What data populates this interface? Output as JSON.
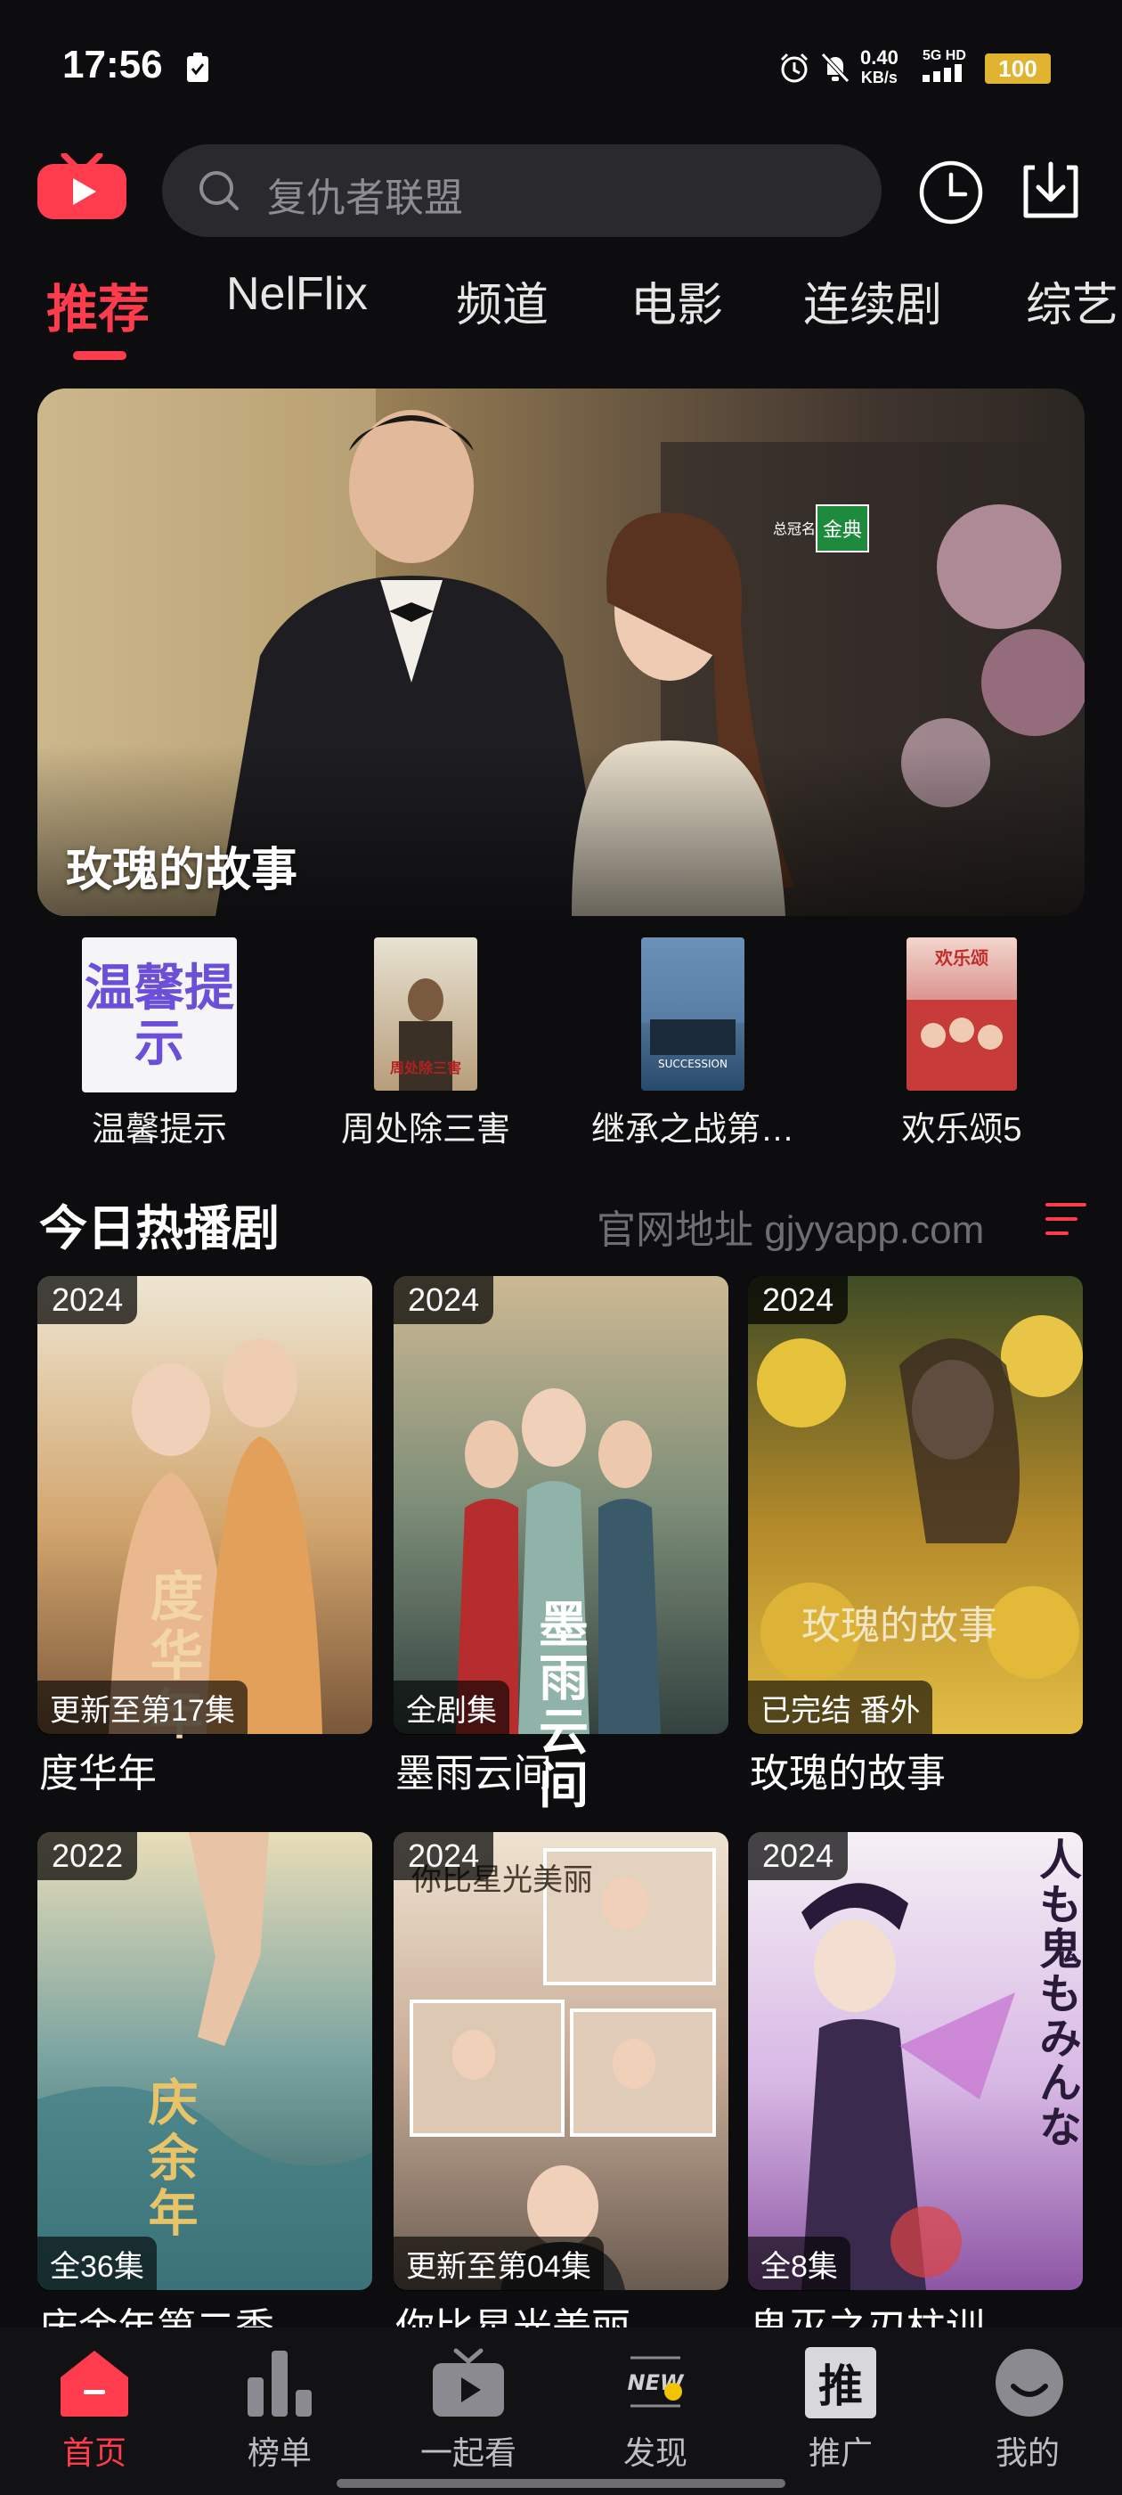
{
  "status_bar": {
    "time": "17:56",
    "network_speed": "0.40",
    "network_unit": "KB/s",
    "signal_text": "5G HD",
    "battery": "100"
  },
  "header": {
    "search_placeholder": "复仇者联盟",
    "icons": [
      "app-logo-icon",
      "search-icon",
      "history-clock-icon",
      "download-icon"
    ]
  },
  "tabs": [
    {
      "label": "推荐",
      "active": true
    },
    {
      "label": "NelFlix"
    },
    {
      "label": "频道"
    },
    {
      "label": "电影"
    },
    {
      "label": "连续剧"
    },
    {
      "label": "综艺"
    }
  ],
  "banner": {
    "title": "玫瑰的故事",
    "badge_pre": "总冠名",
    "badge": "金典"
  },
  "quick_items": [
    {
      "label": "温馨提示",
      "thumb_text": "温馨提示",
      "colors": [
        "#f5f5f8",
        "#6b4fd8"
      ]
    },
    {
      "label": "周处除三害",
      "thumb_text": "周处除三害",
      "colors": [
        "#d9d3c3",
        "#8a6a3c"
      ]
    },
    {
      "label": "继承之战第…",
      "thumb_text": "SUCCESSION",
      "colors": [
        "#2b4f74",
        "#6c8fb1"
      ]
    },
    {
      "label": "欢乐颂5",
      "thumb_text": "欢乐颂",
      "colors": [
        "#c93a3a",
        "#f3d7d0"
      ]
    }
  ],
  "section": {
    "title": "今日热播剧",
    "link": "官网地址 gjyyapp.com"
  },
  "cards": [
    {
      "year": "2024",
      "badge": "更新至第17集",
      "title": "度华年",
      "poster_text": "度华年",
      "colors": [
        "#e9e0cd",
        "#c89a63",
        "#7d5a3c"
      ]
    },
    {
      "year": "2024",
      "badge": "全剧集",
      "title": "墨雨云间",
      "poster_text": "墨雨云间",
      "colors": [
        "#c7b38d",
        "#5e7e74",
        "#2c3d3c"
      ]
    },
    {
      "year": "2024",
      "badge": "已完结 番外",
      "title": "玫瑰的故事",
      "poster_text": "玫瑰的故事",
      "colors": [
        "#3e4a24",
        "#c99a2e",
        "#e4c247"
      ]
    },
    {
      "year": "2022",
      "badge": "全36集",
      "title": "庆余年第二季",
      "poster_text": "庆余年",
      "colors": [
        "#e6d7b1",
        "#5b8a92",
        "#2f5b5e"
      ]
    },
    {
      "year": "2024",
      "badge": "更新至第04集",
      "title": "你比星光美丽",
      "poster_text": "你比星光美丽",
      "colors": [
        "#e7d9c7",
        "#b79b86",
        "#3a3a3a"
      ]
    },
    {
      "year": "2024",
      "badge": "全8集",
      "title": "鬼灭之刃柱训…",
      "poster_text": "人も鬼もみんな",
      "colors": [
        "#f3eef5",
        "#b88ad0",
        "#7a3b8f"
      ]
    }
  ],
  "bottom_nav": [
    {
      "label": "首页",
      "icon": "home-icon",
      "active": true
    },
    {
      "label": "榜单",
      "icon": "chart-icon"
    },
    {
      "label": "一起看",
      "icon": "tv-play-icon"
    },
    {
      "label": "发现",
      "icon": "discover-new-icon",
      "icon_text": "NEW"
    },
    {
      "label": "推广",
      "icon": "promote-icon",
      "icon_text": "推"
    },
    {
      "label": "我的",
      "icon": "profile-icon"
    }
  ],
  "theme": {
    "accent": "#ff3b4e",
    "background": "#0d0d0f"
  }
}
